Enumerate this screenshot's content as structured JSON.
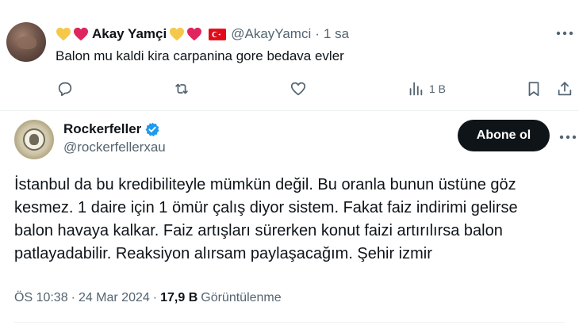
{
  "reply": {
    "name": "Akay Yamçi",
    "handle": "@AkayYamci",
    "separator": "·",
    "time": "1 sa",
    "text": "Balon mu kaldi kira carpanina gore bedava evler",
    "views": "1 B",
    "icons": [
      "reply-icon",
      "retweet-icon",
      "like-icon",
      "views-icon",
      "bookmark-icon",
      "share-icon"
    ],
    "heart_colors": {
      "yellow": "#f5c84c",
      "red": "#e0245e"
    },
    "flag_color": "#e30a17"
  },
  "main": {
    "name": "Rockerfeller",
    "handle": "@rockerfellerxau",
    "follow_label": "Abone ol",
    "text_lines": [
      "İstanbul da bu kredibiliteyle mümkün değil. Bu oranla bunun üstüne göz",
      "kesmez. 1 daire için 1 ömür çalış diyor sistem. Fakat faiz indirimi gelirse",
      "balon havaya kalkar. Faiz artışları sürerken konut faizi artırılırsa balon",
      "patlayadabilir. Reaksiyon alırsam paylaşacağım. Şehir izmir"
    ],
    "time": "ÖS 10:38",
    "separator": "·",
    "date": "24 Mar 2024",
    "views_count": "17,9 B",
    "views_label": "Görüntülenme",
    "verified_color": "#1d9bf0"
  }
}
